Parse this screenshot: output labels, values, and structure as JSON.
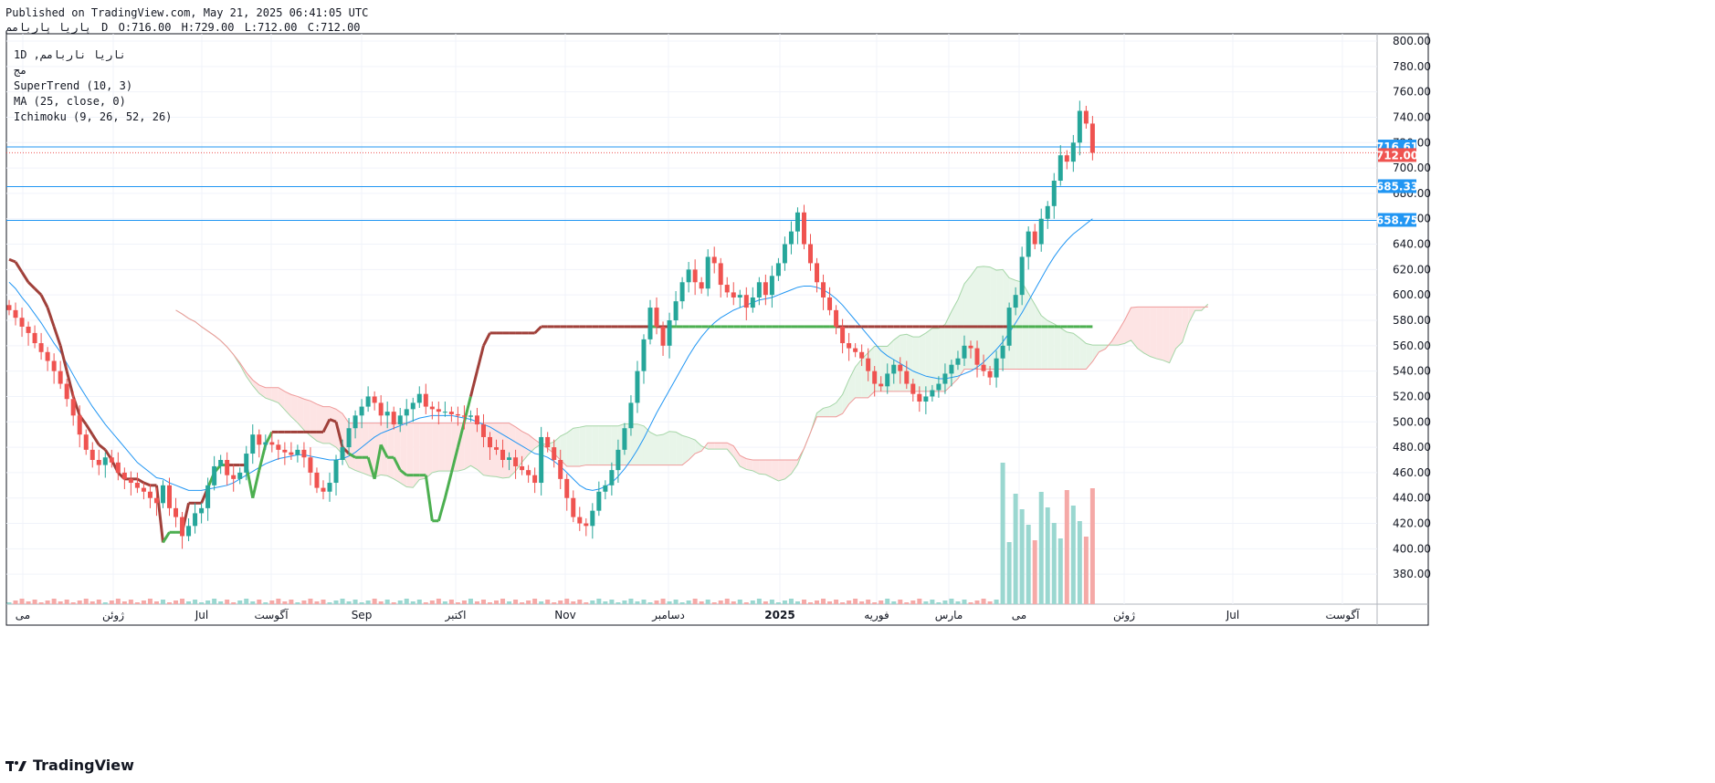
{
  "header": {
    "published": "Published on TradingView.com, May 21, 2025 06:41:05 UTC",
    "symbol": "پاریا پاربامم",
    "interval": "D",
    "open": "O:716.00",
    "high": "H:729.00",
    "low": "L:712.00",
    "close": "C:712.00"
  },
  "legend": {
    "symbol_line": "1D ,ناریا ناربامم",
    "exchange": "مج",
    "supertrend": "SuperTrend (10, 3)",
    "ma": "MA (25, close, 0)",
    "ichimoku": "Ichimoku (9, 26, 52, 26)"
  },
  "brand": {
    "text": "TradingView"
  },
  "colors": {
    "up": "#26a69a",
    "down": "#ef5350",
    "supertrend_up": "#4caf50",
    "supertrend_down": "#a0403a",
    "ma": "#2196f3",
    "hline": "#2196f3",
    "cloud_bull": "#e8f5e9",
    "cloud_bear": "#fde4e4"
  },
  "chart_data": {
    "type": "candlestick",
    "ylim": [
      360,
      800
    ],
    "y_ticks": [
      800,
      780,
      760,
      740,
      720,
      700,
      680,
      660,
      640,
      620,
      600,
      580,
      560,
      540,
      520,
      500,
      480,
      460,
      440,
      420,
      400,
      380
    ],
    "x_ticks": [
      "می",
      "ژوئن",
      "Jul",
      "آگوست",
      "Sep",
      "اکتبر",
      "Nov",
      "دسامبر",
      "2025",
      "فوریه",
      "مارس",
      "می",
      "ژوئن",
      "Jul",
      "آگوست"
    ],
    "last_close": 712.0,
    "last_price_label": "712.00",
    "hlines": [
      {
        "value": 716.61,
        "label": "716.61"
      },
      {
        "value": 685.33,
        "label": "685.33"
      },
      {
        "value": 658.75,
        "label": "658.75"
      }
    ],
    "closes": [
      588,
      582,
      575,
      570,
      562,
      555,
      548,
      540,
      530,
      518,
      505,
      490,
      478,
      470,
      466,
      472,
      468,
      460,
      455,
      452,
      448,
      445,
      440,
      436,
      450,
      432,
      425,
      410,
      418,
      428,
      432,
      450,
      465,
      470,
      458,
      455,
      460,
      475,
      490,
      482,
      484,
      482,
      478,
      476,
      474,
      478,
      472,
      460,
      448,
      445,
      452,
      470,
      480,
      495,
      505,
      512,
      520,
      515,
      505,
      508,
      498,
      505,
      510,
      515,
      522,
      512,
      510,
      508,
      508,
      506,
      505,
      504,
      505,
      498,
      488,
      480,
      478,
      470,
      472,
      465,
      462,
      458,
      452,
      488,
      480,
      470,
      455,
      440,
      425,
      420,
      418,
      430,
      445,
      450,
      462,
      478,
      495,
      515,
      540,
      565,
      590,
      575,
      560,
      580,
      595,
      610,
      620,
      610,
      605,
      630,
      625,
      608,
      602,
      598,
      600,
      590,
      598,
      610,
      600,
      615,
      625,
      640,
      650,
      665,
      640,
      625,
      610,
      598,
      588,
      575,
      562,
      558,
      555,
      550,
      540,
      530,
      528,
      538,
      545,
      540,
      530,
      522,
      516,
      520,
      525,
      530,
      538,
      545,
      550,
      560,
      558,
      545,
      540,
      535,
      550,
      560,
      590,
      600,
      630,
      650,
      640,
      660,
      670,
      690,
      710,
      705,
      720,
      745,
      735,
      712
    ],
    "supertrend": [
      628,
      626,
      618,
      610,
      605,
      600,
      590,
      575,
      560,
      540,
      520,
      505,
      498,
      490,
      482,
      478,
      470,
      460,
      455,
      455,
      455,
      452,
      450,
      450,
      405,
      413,
      413,
      413,
      436,
      436,
      436,
      448,
      460,
      466,
      466,
      466,
      466,
      466,
      440,
      462,
      482,
      492,
      492,
      492,
      492,
      492,
      492,
      492,
      492,
      492,
      502,
      500,
      480,
      475,
      472,
      472,
      472,
      455,
      482,
      472,
      472,
      462,
      458,
      458,
      458,
      458,
      422,
      422,
      440,
      460,
      480,
      500,
      520,
      540,
      560,
      570,
      570,
      570,
      570,
      570,
      570,
      570,
      570,
      575,
      575,
      575,
      575,
      575,
      575,
      575,
      575,
      575,
      575,
      575,
      575,
      575,
      575,
      575,
      575,
      575,
      575,
      575,
      575,
      575,
      575,
      575,
      575,
      575,
      575,
      575,
      575,
      575,
      575,
      575,
      575,
      575,
      575,
      575,
      575,
      575,
      575,
      575,
      575,
      575,
      575,
      575,
      575,
      575,
      575,
      575,
      575,
      575,
      575,
      575,
      575,
      575,
      575,
      575,
      575,
      575,
      575,
      575,
      575,
      575,
      575,
      575,
      575,
      575,
      575,
      575,
      575,
      575,
      575,
      575,
      575,
      575,
      575,
      575,
      575,
      575,
      575,
      575,
      575,
      575,
      575,
      575,
      575,
      575,
      575,
      575
    ],
    "ma": [
      610,
      605,
      598,
      592,
      585,
      578,
      570,
      562,
      555,
      546,
      537,
      528,
      520,
      512,
      505,
      498,
      492,
      486,
      480,
      474,
      468,
      464,
      460,
      456,
      455,
      452,
      450,
      448,
      446,
      446,
      446,
      447,
      448,
      449,
      450,
      452,
      455,
      458,
      461,
      464,
      467,
      469,
      471,
      472,
      473,
      474,
      474,
      473,
      472,
      471,
      470,
      470,
      471,
      473,
      476,
      480,
      484,
      488,
      491,
      493,
      495,
      497,
      499,
      501,
      503,
      504,
      505,
      505,
      505,
      505,
      504,
      503,
      502,
      500,
      498,
      496,
      493,
      490,
      487,
      484,
      481,
      478,
      475,
      474,
      472,
      469,
      465,
      460,
      455,
      450,
      447,
      446,
      447,
      449,
      452,
      457,
      463,
      470,
      478,
      487,
      497,
      507,
      516,
      525,
      534,
      543,
      552,
      560,
      567,
      573,
      578,
      582,
      585,
      588,
      590,
      592,
      594,
      596,
      597,
      598,
      600,
      602,
      604,
      606,
      607,
      607,
      606,
      604,
      601,
      597,
      592,
      586,
      580,
      574,
      568,
      562,
      556,
      552,
      549,
      546,
      543,
      540,
      538,
      536,
      535,
      534,
      534,
      535,
      536,
      538,
      540,
      543,
      547,
      552,
      557,
      563,
      570,
      578,
      586,
      595,
      604,
      613,
      622,
      630,
      637,
      643,
      648,
      652,
      656,
      660
    ],
    "volume_note": "volume bars at bottom, spike in April-May 2025"
  }
}
